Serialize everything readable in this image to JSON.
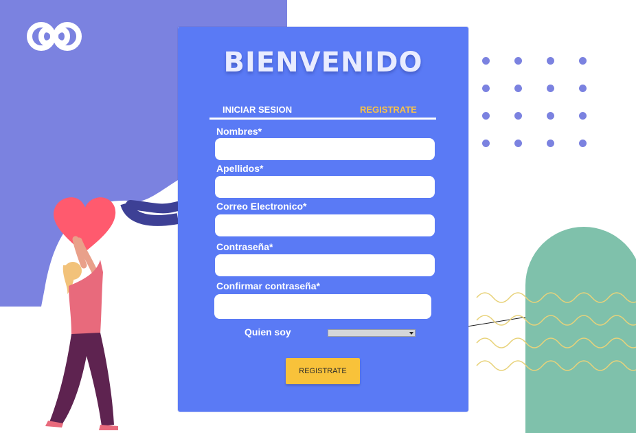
{
  "header": {
    "title": "BIENVENIDO"
  },
  "tabs": {
    "login_label": "INICIAR SESION",
    "register_label": "REGISTRATE"
  },
  "form": {
    "fields": [
      {
        "label": "Nombres*",
        "value": ""
      },
      {
        "label": "Apellidos*",
        "value": ""
      },
      {
        "label": "Correo Electronico*",
        "value": ""
      },
      {
        "label": "Contraseña*",
        "value": ""
      },
      {
        "label": "Confirmar contraseña*",
        "value": ""
      }
    ],
    "role_label": "Quien soy",
    "role_selected": "",
    "submit_label": "REGISTRATE"
  },
  "colors": {
    "card": "#5a7af5",
    "left_blob": "#7b82e0",
    "accent_yellow": "#f8c23a",
    "arch_green": "#7fc1ab"
  },
  "icons": [
    "infinity-logo-icon",
    "heart-icon",
    "select-arrow-icon"
  ]
}
